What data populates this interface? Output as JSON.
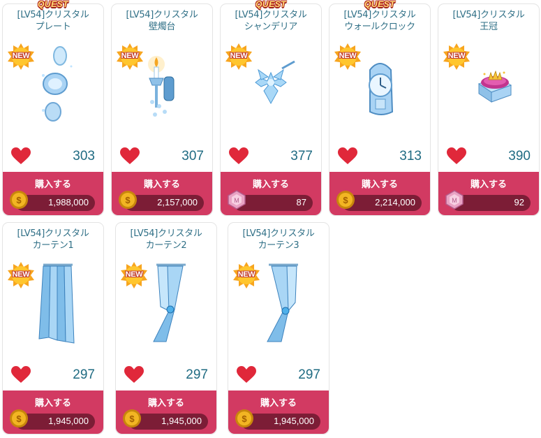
{
  "labels": {
    "buy": "購入する",
    "new": "NEW",
    "quest": "QUEST"
  },
  "colors": {
    "title": "#2f6f86",
    "buy_button": "#d23a62",
    "price_bar": "#7c1d36",
    "likes": "#1f6b82",
    "heart": "#e0283a"
  },
  "items": [
    {
      "title1": "[LV54]クリスタル",
      "title2": "プレート",
      "likes": "303",
      "price": "1,988,000",
      "currency": "coin-icon",
      "quest": true,
      "art": "crystal-plate"
    },
    {
      "title1": "[LV54]クリスタル",
      "title2": "壁燭台",
      "likes": "307",
      "price": "2,157,000",
      "currency": "coin-icon",
      "quest": false,
      "art": "crystal-sconce"
    },
    {
      "title1": "[LV54]クリスタル",
      "title2": "シャンデリア",
      "likes": "377",
      "price": "87",
      "currency": "gem-icon",
      "quest": true,
      "art": "crystal-chandelier"
    },
    {
      "title1": "[LV54]クリスタル",
      "title2": "ウォールクロック",
      "likes": "313",
      "price": "2,214,000",
      "currency": "coin-icon",
      "quest": true,
      "art": "crystal-wall-clock"
    },
    {
      "title1": "[LV54]クリスタル",
      "title2": "王冠",
      "likes": "390",
      "price": "92",
      "currency": "gem-icon",
      "quest": false,
      "art": "crystal-crown"
    },
    {
      "title1": "[LV54]クリスタル",
      "title2": "カーテン1",
      "likes": "297",
      "price": "1,945,000",
      "currency": "coin-icon",
      "quest": false,
      "art": "crystal-curtain-1"
    },
    {
      "title1": "[LV54]クリスタル",
      "title2": "カーテン2",
      "likes": "297",
      "price": "1,945,000",
      "currency": "coin-icon",
      "quest": false,
      "art": "crystal-curtain-2"
    },
    {
      "title1": "[LV54]クリスタル",
      "title2": "カーテン3",
      "likes": "297",
      "price": "1,945,000",
      "currency": "coin-icon",
      "quest": false,
      "art": "crystal-curtain-3"
    }
  ]
}
